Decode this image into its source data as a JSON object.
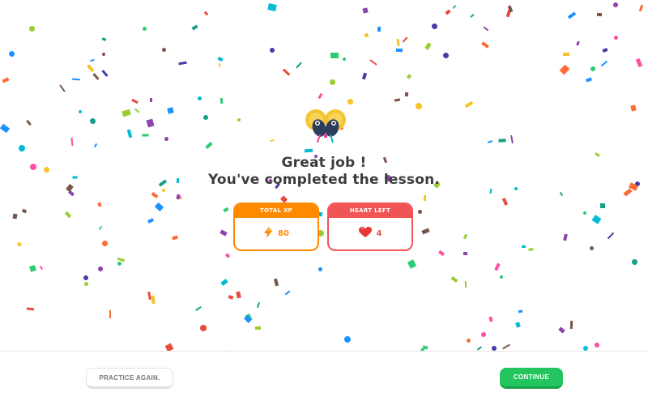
{
  "summary": {
    "line1": "Great job !",
    "line2": "You've completed the lesson."
  },
  "stats": {
    "xp": {
      "label": "TOTAL XP",
      "value": "80",
      "icon": "lightning-icon"
    },
    "hearts": {
      "label": "HEART LEFT",
      "value": "4",
      "icon": "heart-icon"
    }
  },
  "footer": {
    "practice_label": "PRACTICE AGAIN.",
    "continue_label": "CONTINUE"
  },
  "mascot": {
    "icon": "celebrating-mascots-icon"
  },
  "colors": {
    "xp_accent": "#ff8a00",
    "heart_accent": "#f05454",
    "continue_green": "#22c55e",
    "text": "#3c3c3c"
  }
}
